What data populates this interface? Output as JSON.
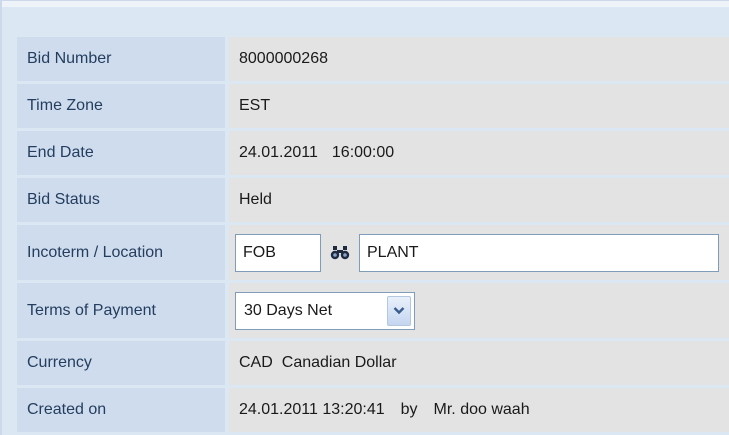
{
  "form": {
    "bid_number": {
      "label": "Bid Number",
      "value": "8000000268"
    },
    "time_zone": {
      "label": "Time Zone",
      "value": "EST"
    },
    "end_date": {
      "label": "End Date",
      "date": "24.01.2011",
      "time": "16:00:00"
    },
    "bid_status": {
      "label": "Bid Status",
      "value": "Held"
    },
    "incoterm": {
      "label": "Incoterm / Location",
      "code": "FOB",
      "location": "PLANT",
      "finder_icon": "binoculars-icon"
    },
    "payment_terms": {
      "label": "Terms of Payment",
      "selected": "30 Days Net",
      "dropdown_icon": "chevron-down-icon"
    },
    "currency": {
      "label": "Currency",
      "code": "CAD",
      "name": "Canadian Dollar"
    },
    "created_on": {
      "label": "Created on",
      "datetime": "24.01.2011 13:20:41",
      "by_label": "by",
      "user": "Mr. doo waah"
    }
  },
  "colors": {
    "label_bg": "#cfdcee",
    "value_bg": "#e3e3e3",
    "label_text": "#233e5e",
    "panel_bg": "#dce7f4"
  }
}
